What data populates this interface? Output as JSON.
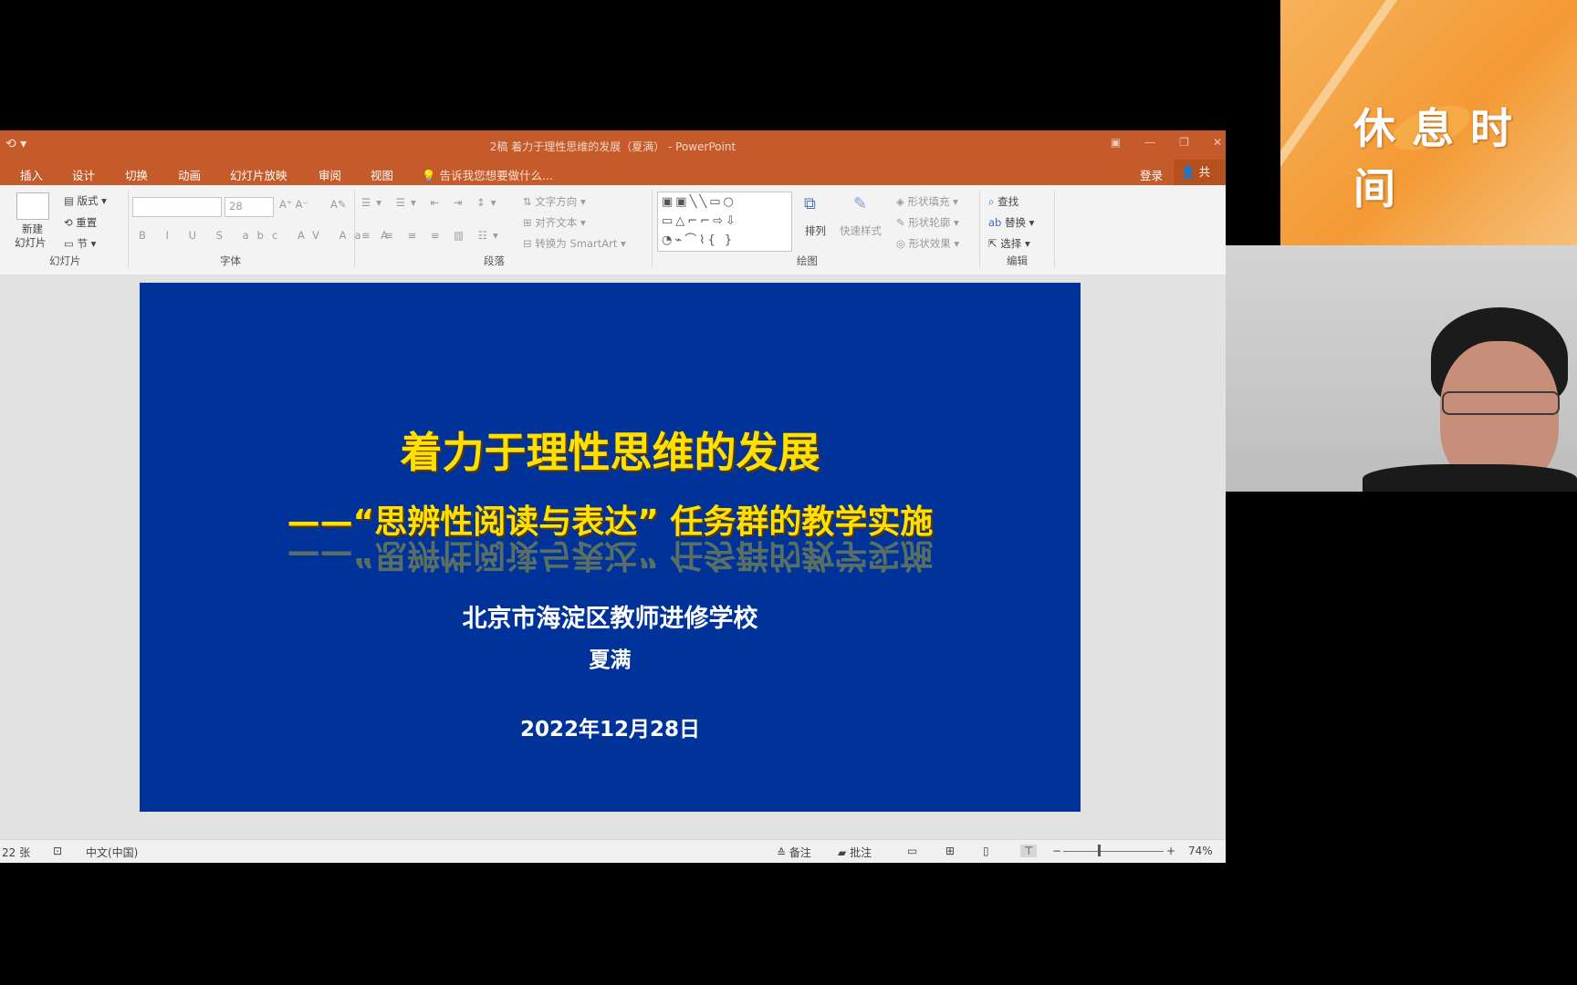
{
  "window": {
    "title": "2稿  着力于理性思维的发展（夏满） - PowerPoint",
    "qat_icon": "autosave-icon"
  },
  "tabs": [
    "插入",
    "设计",
    "切换",
    "动画",
    "幻灯片放映",
    "审阅",
    "视图"
  ],
  "tell_me": "告诉我您想要做什么...",
  "login": "登录",
  "share": "共享",
  "ribbon": {
    "slides": {
      "new_slide": "新建",
      "new_slide2": "幻灯片",
      "layout": "版式",
      "reset": "重置",
      "section": "节",
      "group": "幻灯片"
    },
    "font": {
      "size": "28",
      "group": "字体"
    },
    "paragraph": {
      "text_direction": "文字方向",
      "align_text": "对齐文本",
      "smartart": "转换为 SmartArt",
      "group": "段落"
    },
    "drawing": {
      "arrange": "排列",
      "quick_styles": "快速样式",
      "fill": "形状填充",
      "outline": "形状轮廓",
      "effects": "形状效果",
      "group": "绘图"
    },
    "editing": {
      "find": "查找",
      "replace": "替换",
      "select": "选择",
      "group": "编辑"
    }
  },
  "slide": {
    "title": "着力于理性思维的发展",
    "subtitle": "——“思辨性阅读与表达” 任务群的教学实施",
    "org": "北京市海淀区教师进修学校",
    "author": "夏满",
    "date": "2022年12月28日"
  },
  "status": {
    "slide_count": "22 张",
    "language": "中文(中国)",
    "notes": "备注",
    "comments": "批注",
    "zoom": "74%"
  },
  "break_panel": {
    "text": "休息时间"
  },
  "colors": {
    "accent": "#c55a2b",
    "slide_bg": "#003399",
    "title_yellow": "#ffe000"
  }
}
